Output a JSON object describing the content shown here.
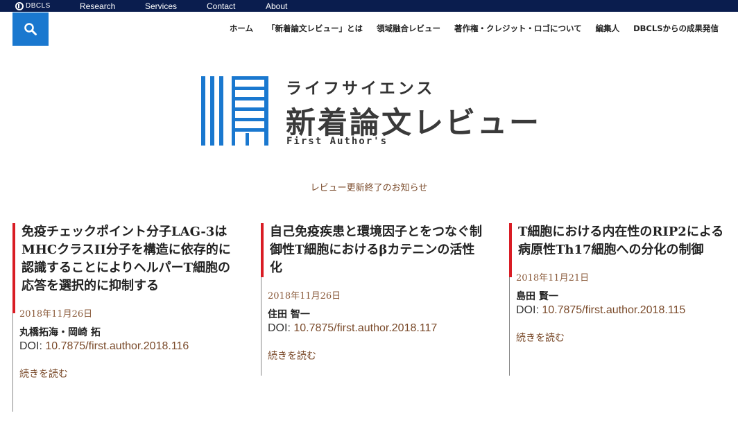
{
  "topbar": {
    "logo_text": "DBCLS",
    "links": [
      "Research",
      "Services",
      "Contact",
      "About"
    ]
  },
  "header": {
    "nav": [
      "ホーム",
      "「新着論文レビュー」とは",
      "領域融合レビュー",
      "著作権・クレジット・ロゴについて",
      "編集人",
      "DBCLSからの成果発信"
    ]
  },
  "logo": {
    "sub": "ライフサイエンス",
    "main": "新着論文レビュー",
    "en": "First Author's"
  },
  "notice": "レビュー更新終了のお知らせ",
  "articles": [
    {
      "title": "免疫チェックポイント分子LAG-3はMHCクラスII分子を構造に依存的に認識することによりヘルパーT細胞の応答を選択的に抑制する",
      "date": "2018年11月26日",
      "authors": "丸橋拓海・岡崎 拓",
      "doi_label": "DOI: ",
      "doi": "10.7875/first.author.2018.116",
      "more": "続きを読む"
    },
    {
      "title": "自己免疫疾患と環境因子とをつなぐ制御性T細胞におけるβカテニンの活性化",
      "date": "2018年11月26日",
      "authors": "住田 智一",
      "doi_label": "DOI: ",
      "doi": "10.7875/first.author.2018.117",
      "more": "続きを読む"
    },
    {
      "title": "T細胞における内在性のRIP2による病原性Th17細胞への分化の制御",
      "date": "2018年11月21日",
      "authors": "島田 賢一",
      "doi_label": "DOI: ",
      "doi": "10.7875/first.author.2018.115",
      "more": "続きを読む"
    }
  ],
  "colors": {
    "topbar": "#0a1d4e",
    "search": "#1a78cf",
    "accent_bar": "#d91c24",
    "link": "#7a4a2a",
    "logo_blue": "#1a78cf"
  },
  "icons": {
    "search": "search-icon"
  }
}
